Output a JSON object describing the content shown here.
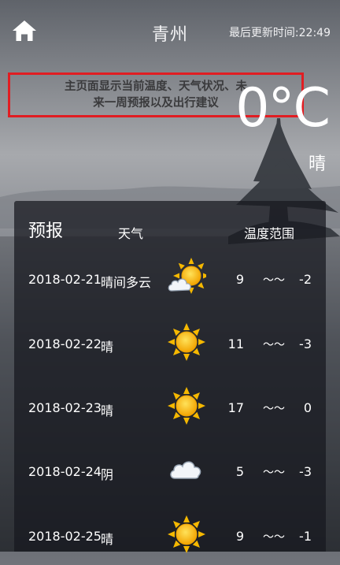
{
  "header": {
    "city": "青州",
    "update": "最后更新时间:22:49"
  },
  "annotation": {
    "line1": "主页面显示当前温度、天气状况、未",
    "line2": "来一周预报以及出行建议"
  },
  "current": {
    "temperature": "0°C",
    "condition": "晴"
  },
  "forecast": {
    "title": "预报",
    "weather_header": "天气",
    "range_header": "温度范围",
    "tilde": "～～",
    "days": [
      {
        "date": "2018-02-21",
        "text": "晴间多云",
        "icon": "partly-cloudy-icon",
        "high": "9",
        "low": "-2"
      },
      {
        "date": "2018-02-22",
        "text": "晴",
        "icon": "sun-icon",
        "high": "11",
        "low": "-3"
      },
      {
        "date": "2018-02-23",
        "text": "晴",
        "icon": "sun-icon",
        "high": "17",
        "low": "0"
      },
      {
        "date": "2018-02-24",
        "text": "阴",
        "icon": "cloud-icon",
        "high": "5",
        "low": "-3"
      },
      {
        "date": "2018-02-25",
        "text": "晴",
        "icon": "sun-icon",
        "high": "9",
        "low": "-1"
      }
    ]
  },
  "colors": {
    "annotation_border": "#e11d22",
    "panel": "#16181e",
    "sun": "#f5b800"
  }
}
